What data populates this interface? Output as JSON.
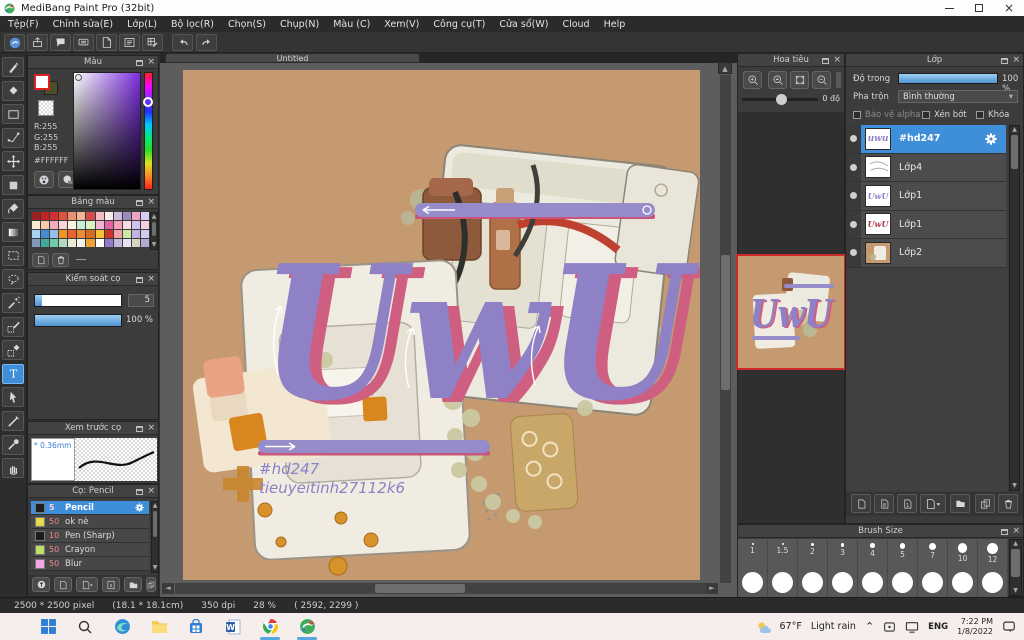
{
  "window": {
    "title": "MediBang Paint Pro (32bit)"
  },
  "menu": [
    "Tệp(F)",
    "Chỉnh sửa(E)",
    "Lớp(L)",
    "Bộ lọc(R)",
    "Chọn(S)",
    "Chụp(N)",
    "Màu (C)",
    "Xem(V)",
    "Công cụ(T)",
    "Cửa sổ(W)",
    "Cloud",
    "Help"
  ],
  "color_panel": {
    "title": "Màu",
    "r": "R:255",
    "g": "G:255",
    "b": "B:255",
    "hex": "#FFFFFF"
  },
  "palette_panel": {
    "title": "Bảng màu",
    "colors": [
      "#9c2121",
      "#c32222",
      "#d33131",
      "#e0553a",
      "#eb8f72",
      "#f2b493",
      "#d14b4b",
      "#f6bcc4",
      "#fbeaea",
      "#cbbce2",
      "#9b8cba",
      "#eba4c4",
      "#dbcaf2",
      "#f6ead7",
      "#f6cbaa",
      "#f2abba",
      "#f9d2da",
      "#f9f2de",
      "#cbeeda",
      "#daf2c2",
      "#f2b2d2",
      "#e263a2",
      "#f2a2ba",
      "#f9dae2",
      "#d2c2ee",
      "#f2d2e2",
      "#aad2f2",
      "#4a8ad2",
      "#92c2ea",
      "#f29222",
      "#ea6232",
      "#f28a32",
      "#da6a22",
      "#f2c232",
      "#d2322a",
      "#f2a2aa",
      "#caeaa2",
      "#c2b2e2",
      "#d2caf2",
      "#8299b9",
      "#42aa9a",
      "#72caa2",
      "#b2dac2",
      "#eaead2",
      "#f2f2ea",
      "#f2a232",
      "#ffffff",
      "#927ac9",
      "#c2bada",
      "#eae2f2",
      "#dad2c2",
      "#b2aad2"
    ]
  },
  "brush_control_panel": {
    "title": "Kiểm soát cọ",
    "size_value": "5",
    "opacity_value": "100 %"
  },
  "brush_preview_panel": {
    "title": "Xem trước cọ",
    "width_label": "* 0.36mm"
  },
  "brush_panel": {
    "title": "Cọ: Pencil",
    "items": [
      {
        "num": "5",
        "name": "Pencil",
        "swatch": "#1e1e1e",
        "selected": true
      },
      {
        "num": "50",
        "name": "ok nè",
        "swatch": "#e6d84a",
        "selected": false
      },
      {
        "num": "10",
        "name": "Pen (Sharp)",
        "swatch": "#1e1e1e",
        "selected": false
      },
      {
        "num": "50",
        "name": "Crayon",
        "swatch": "#bfe36a",
        "selected": false
      },
      {
        "num": "50",
        "name": "Blur",
        "swatch": "#f2a6e4",
        "selected": false
      }
    ]
  },
  "navigator_panel": {
    "title": "Hoa tiêu",
    "rotation_value": "0 độ"
  },
  "layers_panel": {
    "title": "Lớp",
    "opacity_label": "Độ trong",
    "opacity_value": "100 %",
    "blend_label": "Pha trộn",
    "blend_value": "Bình thường",
    "alpha_label": "Bảo vệ alpha",
    "clip_label": "Xén bớt",
    "lock_label": "Khóa",
    "items": [
      {
        "name": "#hd247",
        "selected": true,
        "thumb": "purple-sig"
      },
      {
        "name": "Lớp4",
        "selected": false,
        "thumb": "sketch"
      },
      {
        "name": "Lớp1",
        "selected": false,
        "thumb": "purple-uwu"
      },
      {
        "name": "Lớp1",
        "selected": false,
        "thumb": "red-uwu"
      },
      {
        "name": "Lớp2",
        "selected": false,
        "thumb": "artwork"
      }
    ]
  },
  "brush_size_panel": {
    "title": "Brush Size",
    "sizes": [
      "1",
      "1.5",
      "2",
      "3",
      "4",
      "5",
      "7",
      "10",
      "12"
    ]
  },
  "canvas": {
    "tab": "Untitled",
    "lettering": "UwU",
    "watermark_line1": "#hd247",
    "watermark_line2": "tieuyeitinh27112k6"
  },
  "status": {
    "dimensions": "2500 * 2500 pixel",
    "size_cm": "(18.1 * 18.1cm)",
    "dpi": "350 dpi",
    "zoom": "28 %",
    "cursor": "( 2592, 2299 )"
  },
  "taskbar": {
    "temp": "67°F",
    "weather": "Light rain",
    "lang": "ENG",
    "time": "7:22 PM",
    "date": "1/8/2022"
  },
  "artwork_colors": {
    "canvas_bg": "#c59a71",
    "lettering_fill": "#8e81c6",
    "lettering_shadow": "#cf5f80",
    "bar_fill": "#978cca",
    "bar_edge": "#c9547c",
    "selected_blue": "#3e8eda"
  }
}
